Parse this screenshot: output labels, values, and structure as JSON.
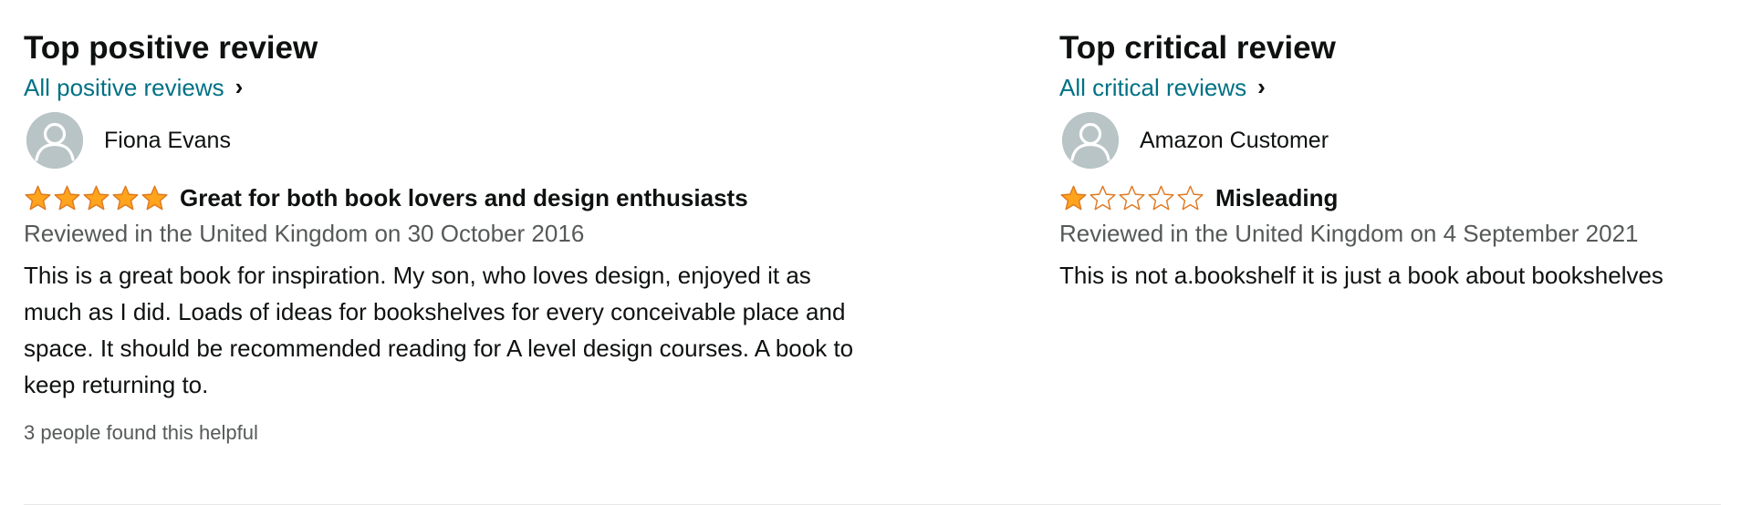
{
  "colors": {
    "link": "#007185",
    "star_fill": "#ffa41c",
    "star_outline": "#de7921",
    "muted_text": "#565959",
    "text": "#0f1111",
    "avatar_bg": "#b8c4c6"
  },
  "positive": {
    "heading": "Top positive review",
    "all_link": "All positive reviews",
    "reviewer_name": "Fiona Evans",
    "rating": 5,
    "max_rating": 5,
    "title": "Great for both book lovers and design enthusiasts",
    "date": "Reviewed in the United Kingdom on 30 October 2016",
    "body": "This is a great book for inspiration. My son, who loves design, enjoyed it as much as I did. Loads of ideas for bookshelves for every conceivable place and space. It should be recommended reading for A level design courses. A book to keep returning to.",
    "helpful": "3 people found this helpful"
  },
  "critical": {
    "heading": "Top critical review",
    "all_link": "All critical reviews",
    "reviewer_name": "Amazon Customer",
    "rating": 1,
    "max_rating": 5,
    "title": "Misleading",
    "date": "Reviewed in the United Kingdom on 4 September 2021",
    "body": "This is not a.bookshelf it is just a book about bookshelves"
  },
  "icons": {
    "avatar": "user-avatar-icon",
    "chevron": "chevron-right-icon",
    "star": "star-icon"
  }
}
